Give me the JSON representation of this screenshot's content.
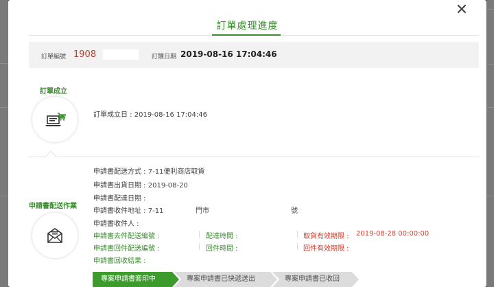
{
  "modal": {
    "title": "訂單處理進度",
    "close_glyph": "✕",
    "order_no_label": "訂單編號",
    "order_no": "1908",
    "order_date_label": "訂購日期",
    "order_date": "2019-08-16 17:04:46"
  },
  "steps": {
    "created": {
      "label": "訂單成立",
      "icon": "laptop-cart-icon",
      "text": "訂單成立日 : 2019-08-16 17:04:46"
    },
    "shipping": {
      "label": "申請書配送作業",
      "icon": "envelope-icon",
      "lines": [
        "申請書配送方式 : 7-11便利商店取貨",
        "申請書出貨日期 : 2019-08-20",
        "申請書配達日期 :",
        "申請書收件地址 : 7-11",
        "申請書收件人 :"
      ],
      "store_suffix": "門市",
      "no_suffix": "號",
      "send_no": "申請書去件配送編號 :",
      "send_time": "配達時間 :",
      "pickup_deadline_label": "取貨有效期限 :",
      "pickup_deadline": "2019-08-28 00:00:00",
      "return_no": "申請書回件配送編號 :",
      "return_time": "回件時間 :",
      "return_deadline_label": "回件有效期限 :",
      "result": "申請書回收結果 :"
    }
  },
  "progress": [
    {
      "label": "專案申請書套印中",
      "active": true
    },
    {
      "label": "專案申請書已快遞送出",
      "active": false
    },
    {
      "label": "專案申請書已收回",
      "active": false
    }
  ],
  "colors": {
    "accent": "#3d8b31",
    "alert": "#d43a2a",
    "order_no": "#c0392b"
  }
}
